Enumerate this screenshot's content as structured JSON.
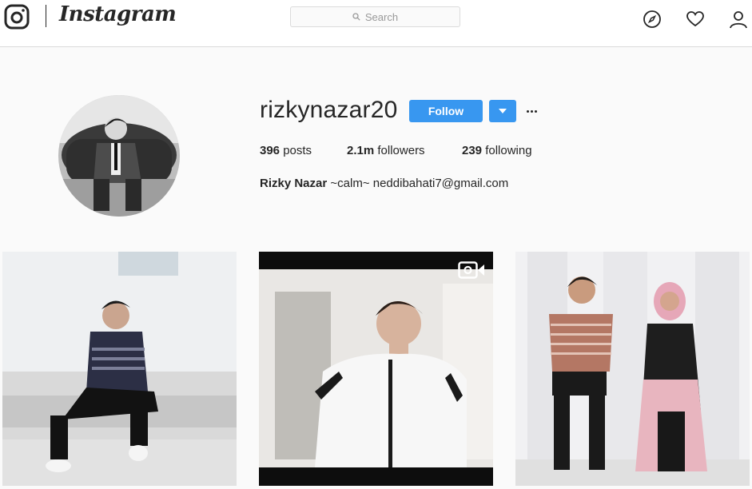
{
  "nav": {
    "wordmark": "Instagram",
    "search_placeholder": "Search",
    "icons": [
      "instagram-glyph-icon",
      "explore-compass-icon",
      "activity-heart-icon",
      "profile-person-icon"
    ]
  },
  "profile": {
    "username": "rizkynazar20",
    "follow_label": "Follow",
    "stats": {
      "posts_value": "396",
      "posts_label": "posts",
      "followers_value": "2.1m",
      "followers_label": "followers",
      "following_value": "239",
      "following_label": "following"
    },
    "bio_name": "Rizky Nazar",
    "bio_text": "~calm~ neddibahati7@gmail.com"
  },
  "colors": {
    "accent": "#3897f0",
    "text": "#262626",
    "background": "#fafafa",
    "border": "#dbdbdb"
  },
  "posts": [
    {
      "type": "photo"
    },
    {
      "type": "video",
      "badge_icon": "video-camera-icon"
    },
    {
      "type": "photo"
    }
  ]
}
